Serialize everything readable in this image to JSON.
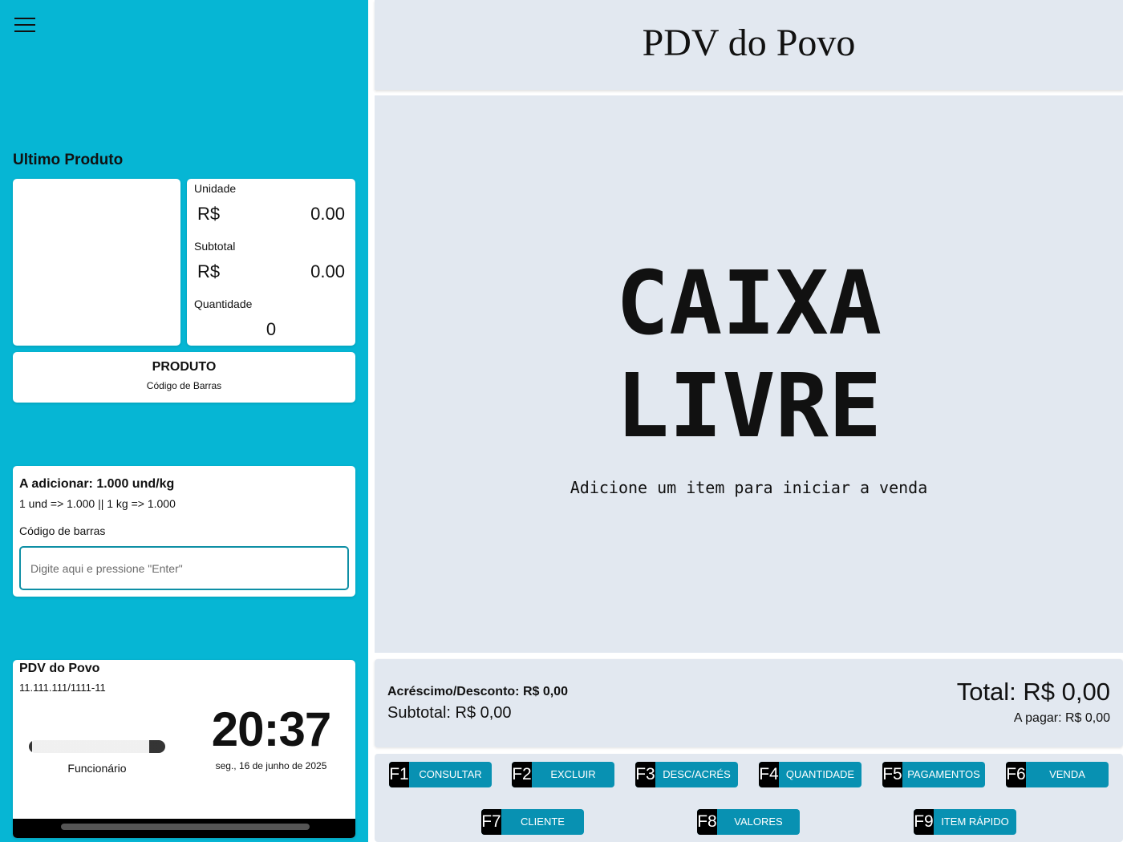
{
  "sidebar": {
    "last_product_title": "Ultimo Produto",
    "unit_label": "Unidade",
    "unit_currency": "R$",
    "unit_value": "0.00",
    "subtotal_label": "Subtotal",
    "subtotal_currency": "R$",
    "subtotal_value": "0.00",
    "quantity_label": "Quantidade",
    "quantity_value": "0",
    "product_name": "PRODUTO",
    "product_code": "Código de Barras",
    "add_title": "A adicionar: 1.000 und/kg",
    "add_rule": "1 und => 1.000 || 1 kg => 1.000",
    "barcode_label": "Código de barras",
    "barcode_placeholder": "Digite aqui e pressione \"Enter\"",
    "store_name": "PDV do Povo",
    "store_cnpj": "11.111.111/1111-11",
    "employee_label": "Funcionário",
    "clock": "20:37",
    "date": "seg., 16 de junho de 2025"
  },
  "header": {
    "title": "PDV do Povo"
  },
  "status": {
    "line1": "CAIXA",
    "line2": "LIVRE",
    "subtitle": "Adicione um item para iniciar a venda"
  },
  "totals": {
    "adjustment": "Acréscimo/Desconto: R$ 0,00",
    "subtotal": "Subtotal: R$ 0,00",
    "total": "Total: R$ 0,00",
    "to_pay": "A pagar: R$ 0,00"
  },
  "fkeys": [
    {
      "key": "F1",
      "label": "CONSULTAR"
    },
    {
      "key": "F2",
      "label": "EXCLUIR"
    },
    {
      "key": "F3",
      "label": "DESC/ACRÉS"
    },
    {
      "key": "F4",
      "label": "QUANTIDADE"
    },
    {
      "key": "F5",
      "label": "PAGAMENTOS"
    },
    {
      "key": "F6",
      "label": "VENDA"
    },
    {
      "key": "F7",
      "label": "CLIENTE"
    },
    {
      "key": "F8",
      "label": "VALORES"
    },
    {
      "key": "F9",
      "label": "ITEM RÁPIDO"
    }
  ],
  "colors": {
    "sidebar": "#06b6d4",
    "panel": "#e2e8f0",
    "button": "#0891b2",
    "key": "#000000"
  }
}
